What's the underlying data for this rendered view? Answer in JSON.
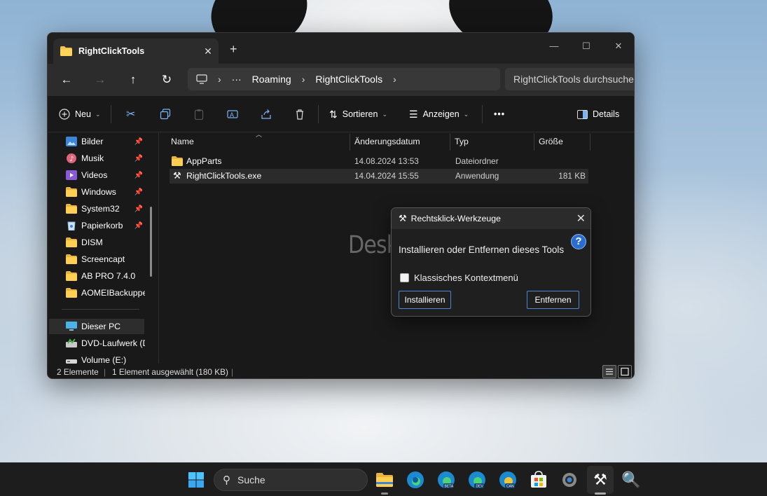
{
  "explorer": {
    "tab_title": "RightClickTools",
    "breadcrumb": [
      "Roaming",
      "RightClickTools"
    ],
    "search_placeholder": "RightClickTools durchsuchen",
    "toolbar": {
      "new_label": "Neu",
      "sort_label": "Sortieren",
      "view_label": "Anzeigen",
      "more_label": "•••",
      "details_label": "Details"
    },
    "sidebar": {
      "items": [
        {
          "label": "Bilder",
          "icon": "pictures-icon",
          "pinned": true
        },
        {
          "label": "Musik",
          "icon": "music-icon",
          "pinned": true
        },
        {
          "label": "Videos",
          "icon": "videos-icon",
          "pinned": true
        },
        {
          "label": "Windows",
          "icon": "folder-icon",
          "pinned": true
        },
        {
          "label": "System32",
          "icon": "folder-icon",
          "pinned": true
        },
        {
          "label": "Papierkorb",
          "icon": "recycle-bin-icon",
          "pinned": true
        },
        {
          "label": "DISM",
          "icon": "folder-icon",
          "pinned": false
        },
        {
          "label": "Screencapt",
          "icon": "folder-icon",
          "pinned": false
        },
        {
          "label": "AB PRO 7.4.0",
          "icon": "folder-icon",
          "pinned": false
        },
        {
          "label": "AOMEIBackupper",
          "icon": "folder-icon",
          "pinned": false
        }
      ],
      "drives": [
        {
          "label": "Dieser PC",
          "icon": "this-pc-icon"
        },
        {
          "label": "DVD-Laufwerk (D:",
          "icon": "dvd-drive-icon"
        },
        {
          "label": "Volume (E:)",
          "icon": "drive-icon"
        }
      ]
    },
    "columns": [
      "Name",
      "Änderungsdatum",
      "Typ",
      "Größe"
    ],
    "files": [
      {
        "name": "AppParts",
        "modified": "14.08.2024 13:53",
        "type": "Dateiordner",
        "size": "",
        "icon": "folder-icon"
      },
      {
        "name": "RightClickTools.exe",
        "modified": "14.04.2024 15:55",
        "type": "Anwendung",
        "size": "181 KB",
        "icon": "tool-icon"
      }
    ],
    "status": {
      "count": "2 Elemente",
      "selection": "1 Element ausgewählt (180 KB)"
    }
  },
  "dialog": {
    "title": "Rechtsklick-Werkzeuge",
    "message": "Installieren oder Entfernen dieses Tools",
    "checkbox_label": "Klassisches Kontextmenü",
    "checkbox_checked": false,
    "install_label": "Installieren",
    "remove_label": "Entfernen"
  },
  "watermark": "Deskmodder.de",
  "taskbar": {
    "search_label": "Suche",
    "apps": [
      "start-icon",
      "file-explorer-icon",
      "edge-icon",
      "edge-beta-icon",
      "edge-dev-icon",
      "edge-canary-icon",
      "store-icon",
      "settings-icon",
      "tool-icon",
      "magnifier-icon"
    ]
  }
}
